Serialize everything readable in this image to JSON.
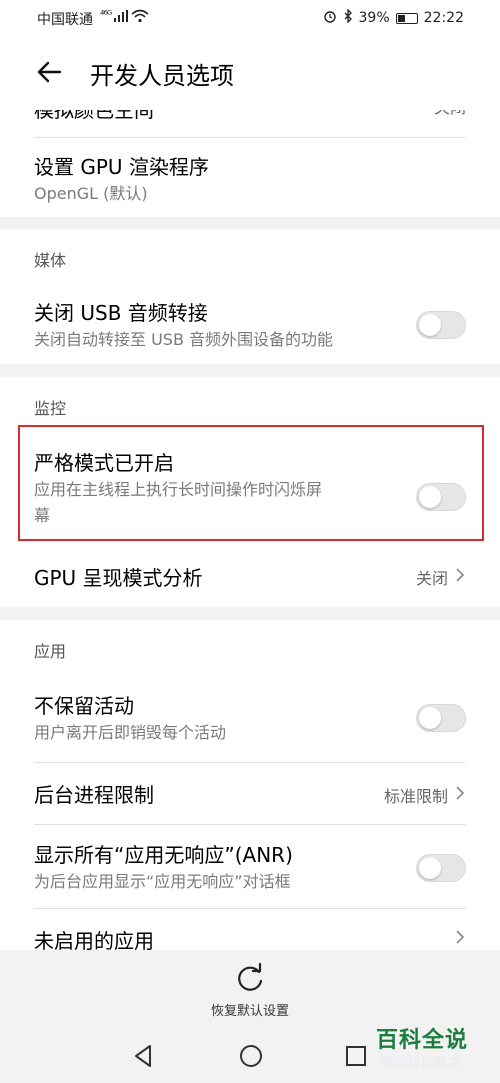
{
  "status_bar": {
    "carrier": "中国联通",
    "network": "⁴⁶ᴳ",
    "battery": "39%",
    "battery_level": 0.39,
    "time": "22:22"
  },
  "header": {
    "title": "开发人员选项"
  },
  "partial_row": {
    "title": "模拟颜色空间",
    "value": "关闭"
  },
  "gpu_renderer": {
    "title": "设置 GPU 渲染程序",
    "value": "OpenGL (默认)"
  },
  "media": {
    "header": "媒体",
    "usb_audio": {
      "title": "关闭 USB 音频转接",
      "subtitle": "关闭自动转接至 USB 音频外围设备的功能",
      "on": false
    }
  },
  "monitoring": {
    "header": "监控",
    "strict_mode": {
      "title": "严格模式已开启",
      "subtitle_line1": "应用在主线程上执行长时间操作时闪烁屏",
      "subtitle_line2": "幕",
      "on": false
    },
    "gpu_profile": {
      "title": "GPU 呈现模式分析",
      "value": "关闭"
    }
  },
  "apps": {
    "header": "应用",
    "dont_keep": {
      "title": "不保留活动",
      "subtitle": "用户离开后即销毁每个活动",
      "on": false
    },
    "bg_limit": {
      "title": "后台进程限制",
      "value": "标准限制"
    },
    "anr": {
      "title": "显示所有“应用无响应”(ANR)",
      "subtitle": "为后台应用显示“应用无响应”对话框",
      "on": false
    },
    "inactive": {
      "title": "未启用的应用"
    }
  },
  "reset": {
    "label": "恢复默认设置"
  },
  "watermark": {
    "top": "百科全说",
    "bottom": "助你轻松解决"
  },
  "colors": {
    "highlight": "#d82b2b",
    "watermark": "#1a7f3c"
  }
}
